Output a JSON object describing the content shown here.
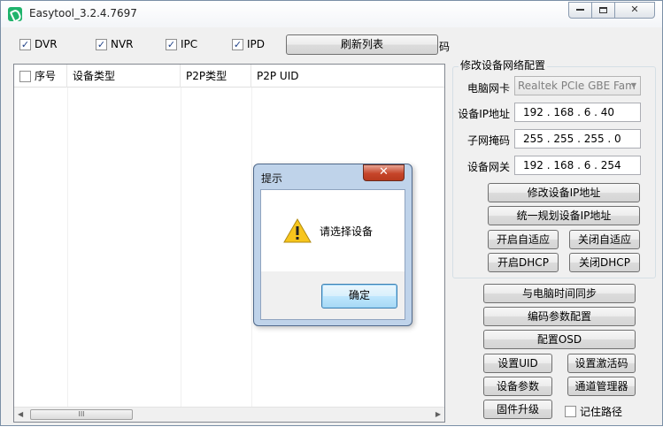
{
  "window": {
    "title": "Easytool_3.2.4.7697",
    "min": "□",
    "max": "▢",
    "close": "✕"
  },
  "filters": {
    "items": [
      {
        "label": "DVR",
        "checked": true
      },
      {
        "label": "NVR",
        "checked": true
      },
      {
        "label": "IPC",
        "checked": true
      },
      {
        "label": "IPD",
        "checked": true
      }
    ],
    "refresh_label": "刷新列表",
    "cut_label": "码"
  },
  "table": {
    "columns": [
      "序号",
      "设备类型",
      "P2P类型",
      "P2P UID"
    ],
    "scroll_thumb_grip": "III",
    "scroll_left": "◀",
    "scroll_right": "▶"
  },
  "network": {
    "title": "修改设备网络配置",
    "nic_label": "电脑网卡",
    "nic_value": "Realtek PCIe GBE Fam",
    "ip_label": "设备IP地址",
    "ip_value": "192 . 168 .  6  . 40",
    "mask_label": "子网掩码",
    "mask_value": "255 . 255 . 255 .  0",
    "gw_label": "设备网关",
    "gw_value": "192 . 168 .  6  . 254",
    "modify_ip": "修改设备IP地址",
    "plan_ip": "统一规划设备IP地址",
    "adapt_on": "开启自适应",
    "adapt_off": "关闭自适应",
    "dhcp_on": "开启DHCP",
    "dhcp_off": "关闭DHCP"
  },
  "actions": {
    "sync_time": "与电脑时间同步",
    "encode_cfg": "编码参数配置",
    "osd_cfg": "配置OSD",
    "set_uid": "设置UID",
    "set_activation": "设置激活码",
    "device_params": "设备参数",
    "channel_mgr": "通道管理器",
    "firmware": "固件升级",
    "remember_path": "记住路径"
  },
  "dialog": {
    "title": "提示",
    "close": "✕",
    "message": "请选择设备",
    "ok": "确定"
  },
  "colors": {
    "accent": "#1fb36b",
    "dialog_frame": "#bfd3ea",
    "warning": "#f7c51c"
  }
}
